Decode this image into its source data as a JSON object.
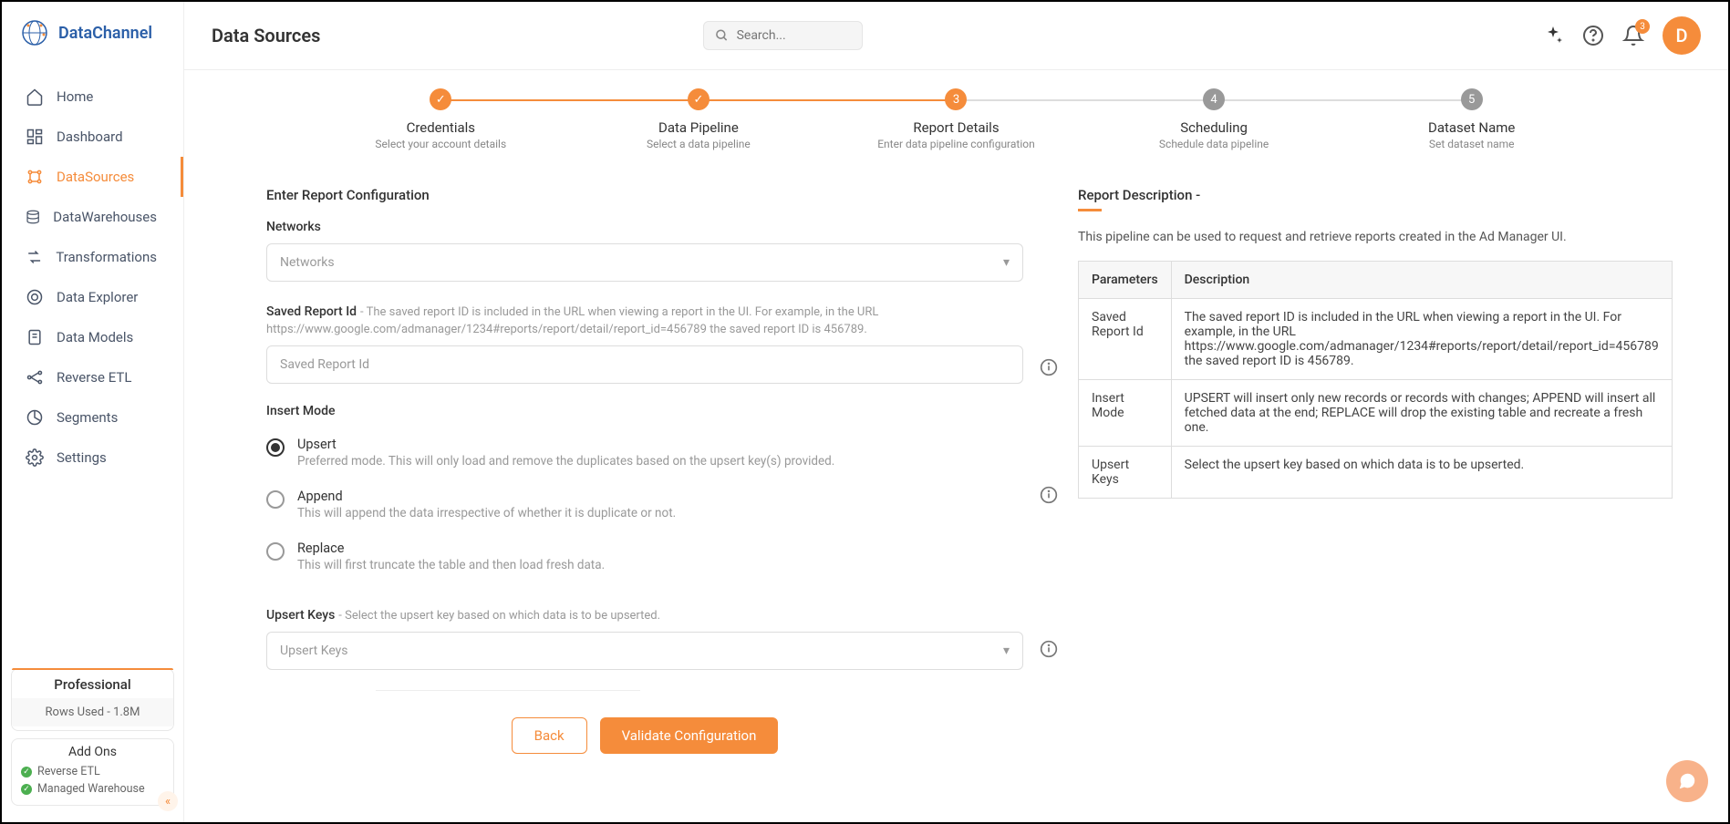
{
  "brand": {
    "name": "DataChannel"
  },
  "header": {
    "title": "Data Sources",
    "search_placeholder": "Search...",
    "notification_count": "3",
    "avatar_letter": "D"
  },
  "nav": {
    "items": [
      {
        "label": "Home"
      },
      {
        "label": "Dashboard"
      },
      {
        "label": "DataSources"
      },
      {
        "label": "DataWarehouses"
      },
      {
        "label": "Transformations"
      },
      {
        "label": "Data Explorer"
      },
      {
        "label": "Data Models"
      },
      {
        "label": "Reverse ETL"
      },
      {
        "label": "Segments"
      },
      {
        "label": "Settings"
      }
    ]
  },
  "plan": {
    "tier": "Professional",
    "rows": "Rows Used - 1.8M",
    "addons_title": "Add Ons",
    "addons": [
      "Reverse ETL",
      "Managed Warehouse"
    ]
  },
  "stepper": [
    {
      "title": "Credentials",
      "sub": "Select your account details",
      "state": "done",
      "mark": "✓"
    },
    {
      "title": "Data Pipeline",
      "sub": "Select a data pipeline",
      "state": "done",
      "mark": "✓"
    },
    {
      "title": "Report Details",
      "sub": "Enter data pipeline configuration",
      "state": "current",
      "mark": "3"
    },
    {
      "title": "Scheduling",
      "sub": "Schedule data pipeline",
      "state": "pending",
      "mark": "4"
    },
    {
      "title": "Dataset Name",
      "sub": "Set dataset name",
      "state": "pending",
      "mark": "5"
    }
  ],
  "form": {
    "heading": "Enter Report Configuration",
    "networks": {
      "label": "Networks",
      "placeholder": "Networks"
    },
    "saved_report": {
      "label": "Saved Report Id",
      "hint": " - The saved report ID is included in the URL when viewing a report in the UI. For example, in the URL https://www.google.com/admanager/1234#reports/report/detail/report_id=456789 the saved report ID is 456789.",
      "placeholder": "Saved Report Id"
    },
    "insert_mode": {
      "label": "Insert Mode",
      "options": [
        {
          "title": "Upsert",
          "desc": "Preferred mode. This will only load and remove the duplicates based on the upsert key(s) provided.",
          "checked": true
        },
        {
          "title": "Append",
          "desc": "This will append the data irrespective of whether it is duplicate or not.",
          "checked": false
        },
        {
          "title": "Replace",
          "desc": "This will first truncate the table and then load fresh data.",
          "checked": false
        }
      ]
    },
    "upsert_keys": {
      "label": "Upsert Keys",
      "hint": " - Select the upsert key based on which data is to be upserted.",
      "placeholder": "Upsert Keys"
    }
  },
  "description": {
    "title": "Report Description -",
    "text": "This pipeline can be used to request and retrieve reports created in the Ad Manager UI.",
    "columns": [
      "Parameters",
      "Description"
    ],
    "rows": [
      [
        "Saved Report Id",
        "The saved report ID is included in the URL when viewing a report in the UI. For example, in the URL https://www.google.com/admanager/1234#reports/report/detail/report_id=456789 the saved report ID is 456789."
      ],
      [
        "Insert Mode",
        "UPSERT will insert only new records or records with changes; APPEND will insert all fetched data at the end; REPLACE will drop the existing table and recreate a fresh one."
      ],
      [
        "Upsert Keys",
        "Select the upsert key based on which data is to be upserted."
      ]
    ]
  },
  "buttons": {
    "back": "Back",
    "validate": "Validate Configuration"
  }
}
